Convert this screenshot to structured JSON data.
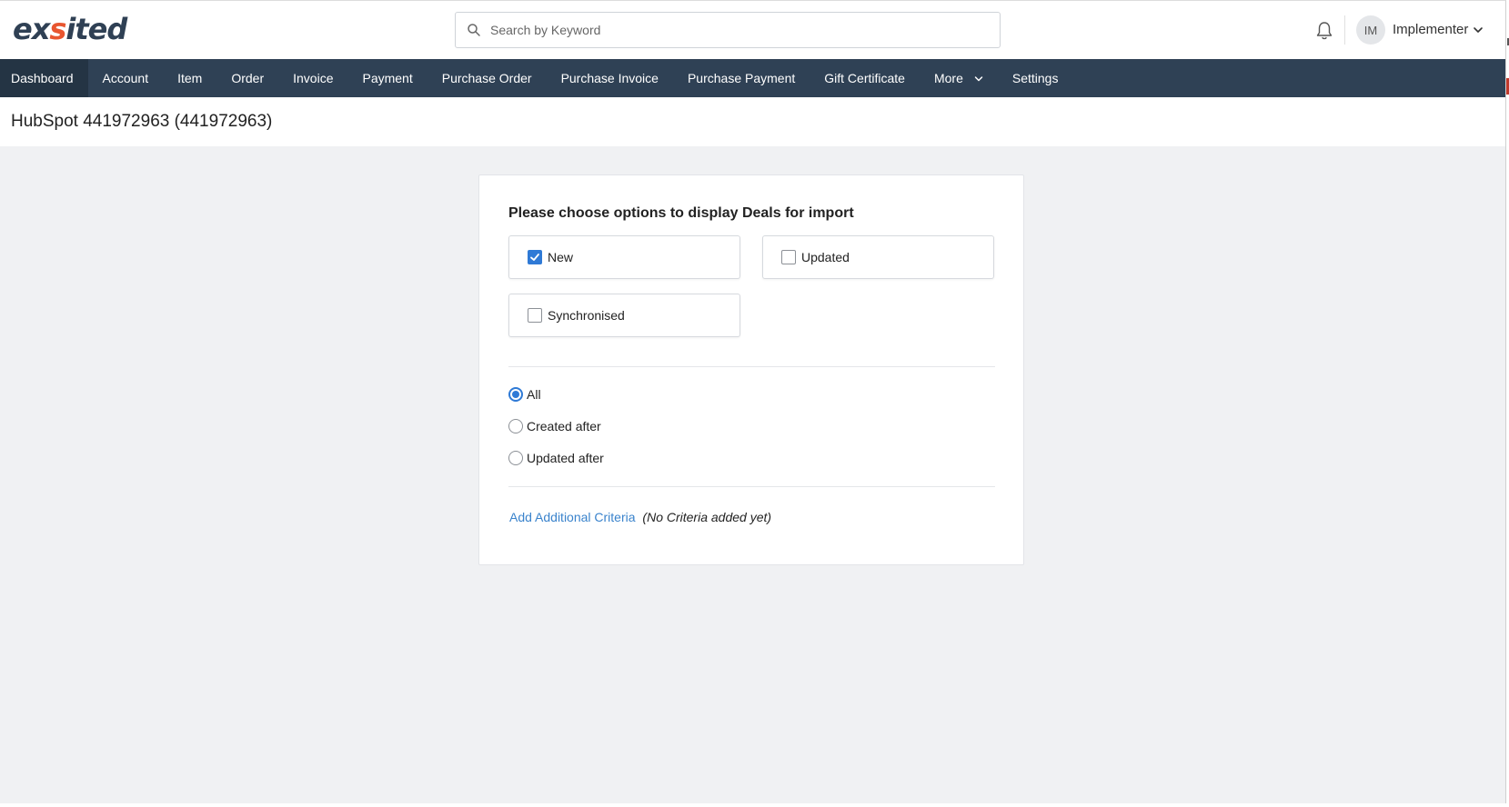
{
  "header": {
    "logo_left": "ex",
    "logo_accent": "s",
    "logo_right": "ited",
    "search_placeholder": "Search by Keyword",
    "avatar_initials": "IM",
    "user_name": "Implementer"
  },
  "nav": {
    "items": [
      "Dashboard",
      "Account",
      "Item",
      "Order",
      "Invoice",
      "Payment",
      "Purchase Order",
      "Purchase Invoice",
      "Purchase Payment",
      "Gift Certificate",
      "More",
      "Settings"
    ],
    "active": "Dashboard"
  },
  "page": {
    "title": "HubSpot 441972963 (441972963)"
  },
  "form": {
    "heading": "Please choose options to display Deals for import",
    "checkboxes": {
      "new": {
        "label": "New",
        "checked": true
      },
      "updated": {
        "label": "Updated",
        "checked": false
      },
      "synchronised": {
        "label": "Synchronised",
        "checked": false
      }
    },
    "radios": {
      "all": {
        "label": "All",
        "selected": true
      },
      "created_after": {
        "label": "Created after",
        "selected": false
      },
      "updated_after": {
        "label": "Updated after",
        "selected": false
      }
    },
    "criteria_link": "Add Additional Criteria",
    "criteria_note": "(No Criteria added yet)"
  },
  "colors": {
    "nav_bg": "#2f4155",
    "accent_blue": "#2f7ad6",
    "link_blue": "#3a83cc",
    "logo_orange": "#e8552f"
  }
}
